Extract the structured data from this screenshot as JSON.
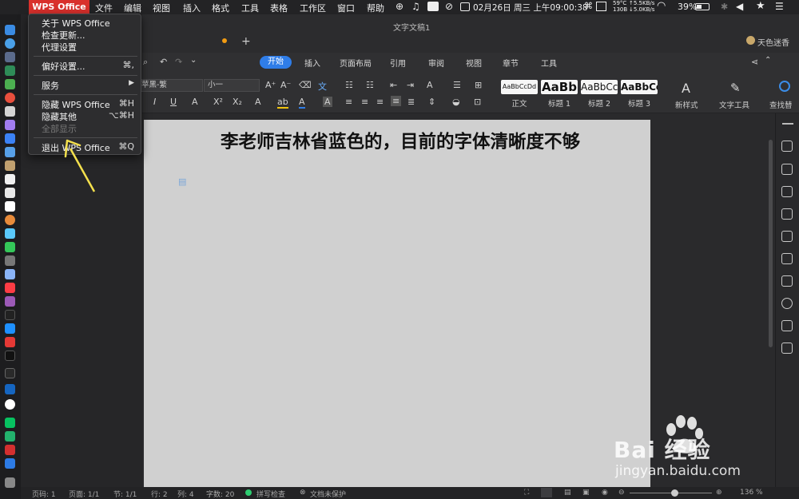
{
  "menubar": {
    "app_name": "WPS Office",
    "menus": [
      "文件",
      "编辑",
      "视图",
      "插入",
      "格式",
      "工具",
      "表格",
      "工作区",
      "窗口",
      "帮助"
    ],
    "temp": "59°C",
    "mem": "130B",
    "net_up": "↑5.5KB/s",
    "net_down": "↓5.0KB/s",
    "datetime": "02月26日 周三 上午09:00:38",
    "battery": "39%"
  },
  "app_menu": {
    "items": [
      {
        "label": "关于 WPS Office",
        "shortcut": ""
      },
      {
        "label": "检查更新...",
        "shortcut": ""
      },
      {
        "label": "代理设置",
        "shortcut": ""
      },
      {
        "label": "偏好设置...",
        "shortcut": "⌘,"
      },
      {
        "label": "服务",
        "shortcut": "▶"
      },
      {
        "label": "隐藏 WPS Office",
        "shortcut": "⌘H"
      },
      {
        "label": "隐藏其他",
        "shortcut": "⌥⌘H"
      },
      {
        "label": "全部显示",
        "shortcut": ""
      },
      {
        "label": "退出 WPS Office",
        "shortcut": "⌘Q"
      }
    ]
  },
  "window": {
    "title": "文字文稿1",
    "user": "天色迷香"
  },
  "ribbon_tabs": [
    "开始",
    "插入",
    "页面布局",
    "引用",
    "审阅",
    "视图",
    "章节",
    "工具"
  ],
  "ribbon": {
    "font_name": "苹黑-繁",
    "font_size": "小一",
    "styles": [
      {
        "preview": "AaBbCcDd",
        "label": "正文"
      },
      {
        "preview": "AaBb",
        "label": "标题 1"
      },
      {
        "preview": "AaBbCc",
        "label": "标题 2"
      },
      {
        "preview": "AaBbCc",
        "label": "标题 3"
      }
    ],
    "new_style": "新样式",
    "text_tools": "文字工具",
    "find": "查找替"
  },
  "document": {
    "text": "李老师吉林省蓝色的，目前的字体清晰度不够"
  },
  "statusbar": {
    "page": "页码: 1",
    "pages": "页面: 1/1",
    "section": "节: 1/1",
    "row": "行: 2",
    "col": "列: 4",
    "words": "字数: 20",
    "spell": "拼写检查",
    "protect": "文档未保护",
    "zoom": "136 %"
  },
  "watermark": {
    "brand": "Bai  经验",
    "url": "jingyan.baidu.com"
  }
}
